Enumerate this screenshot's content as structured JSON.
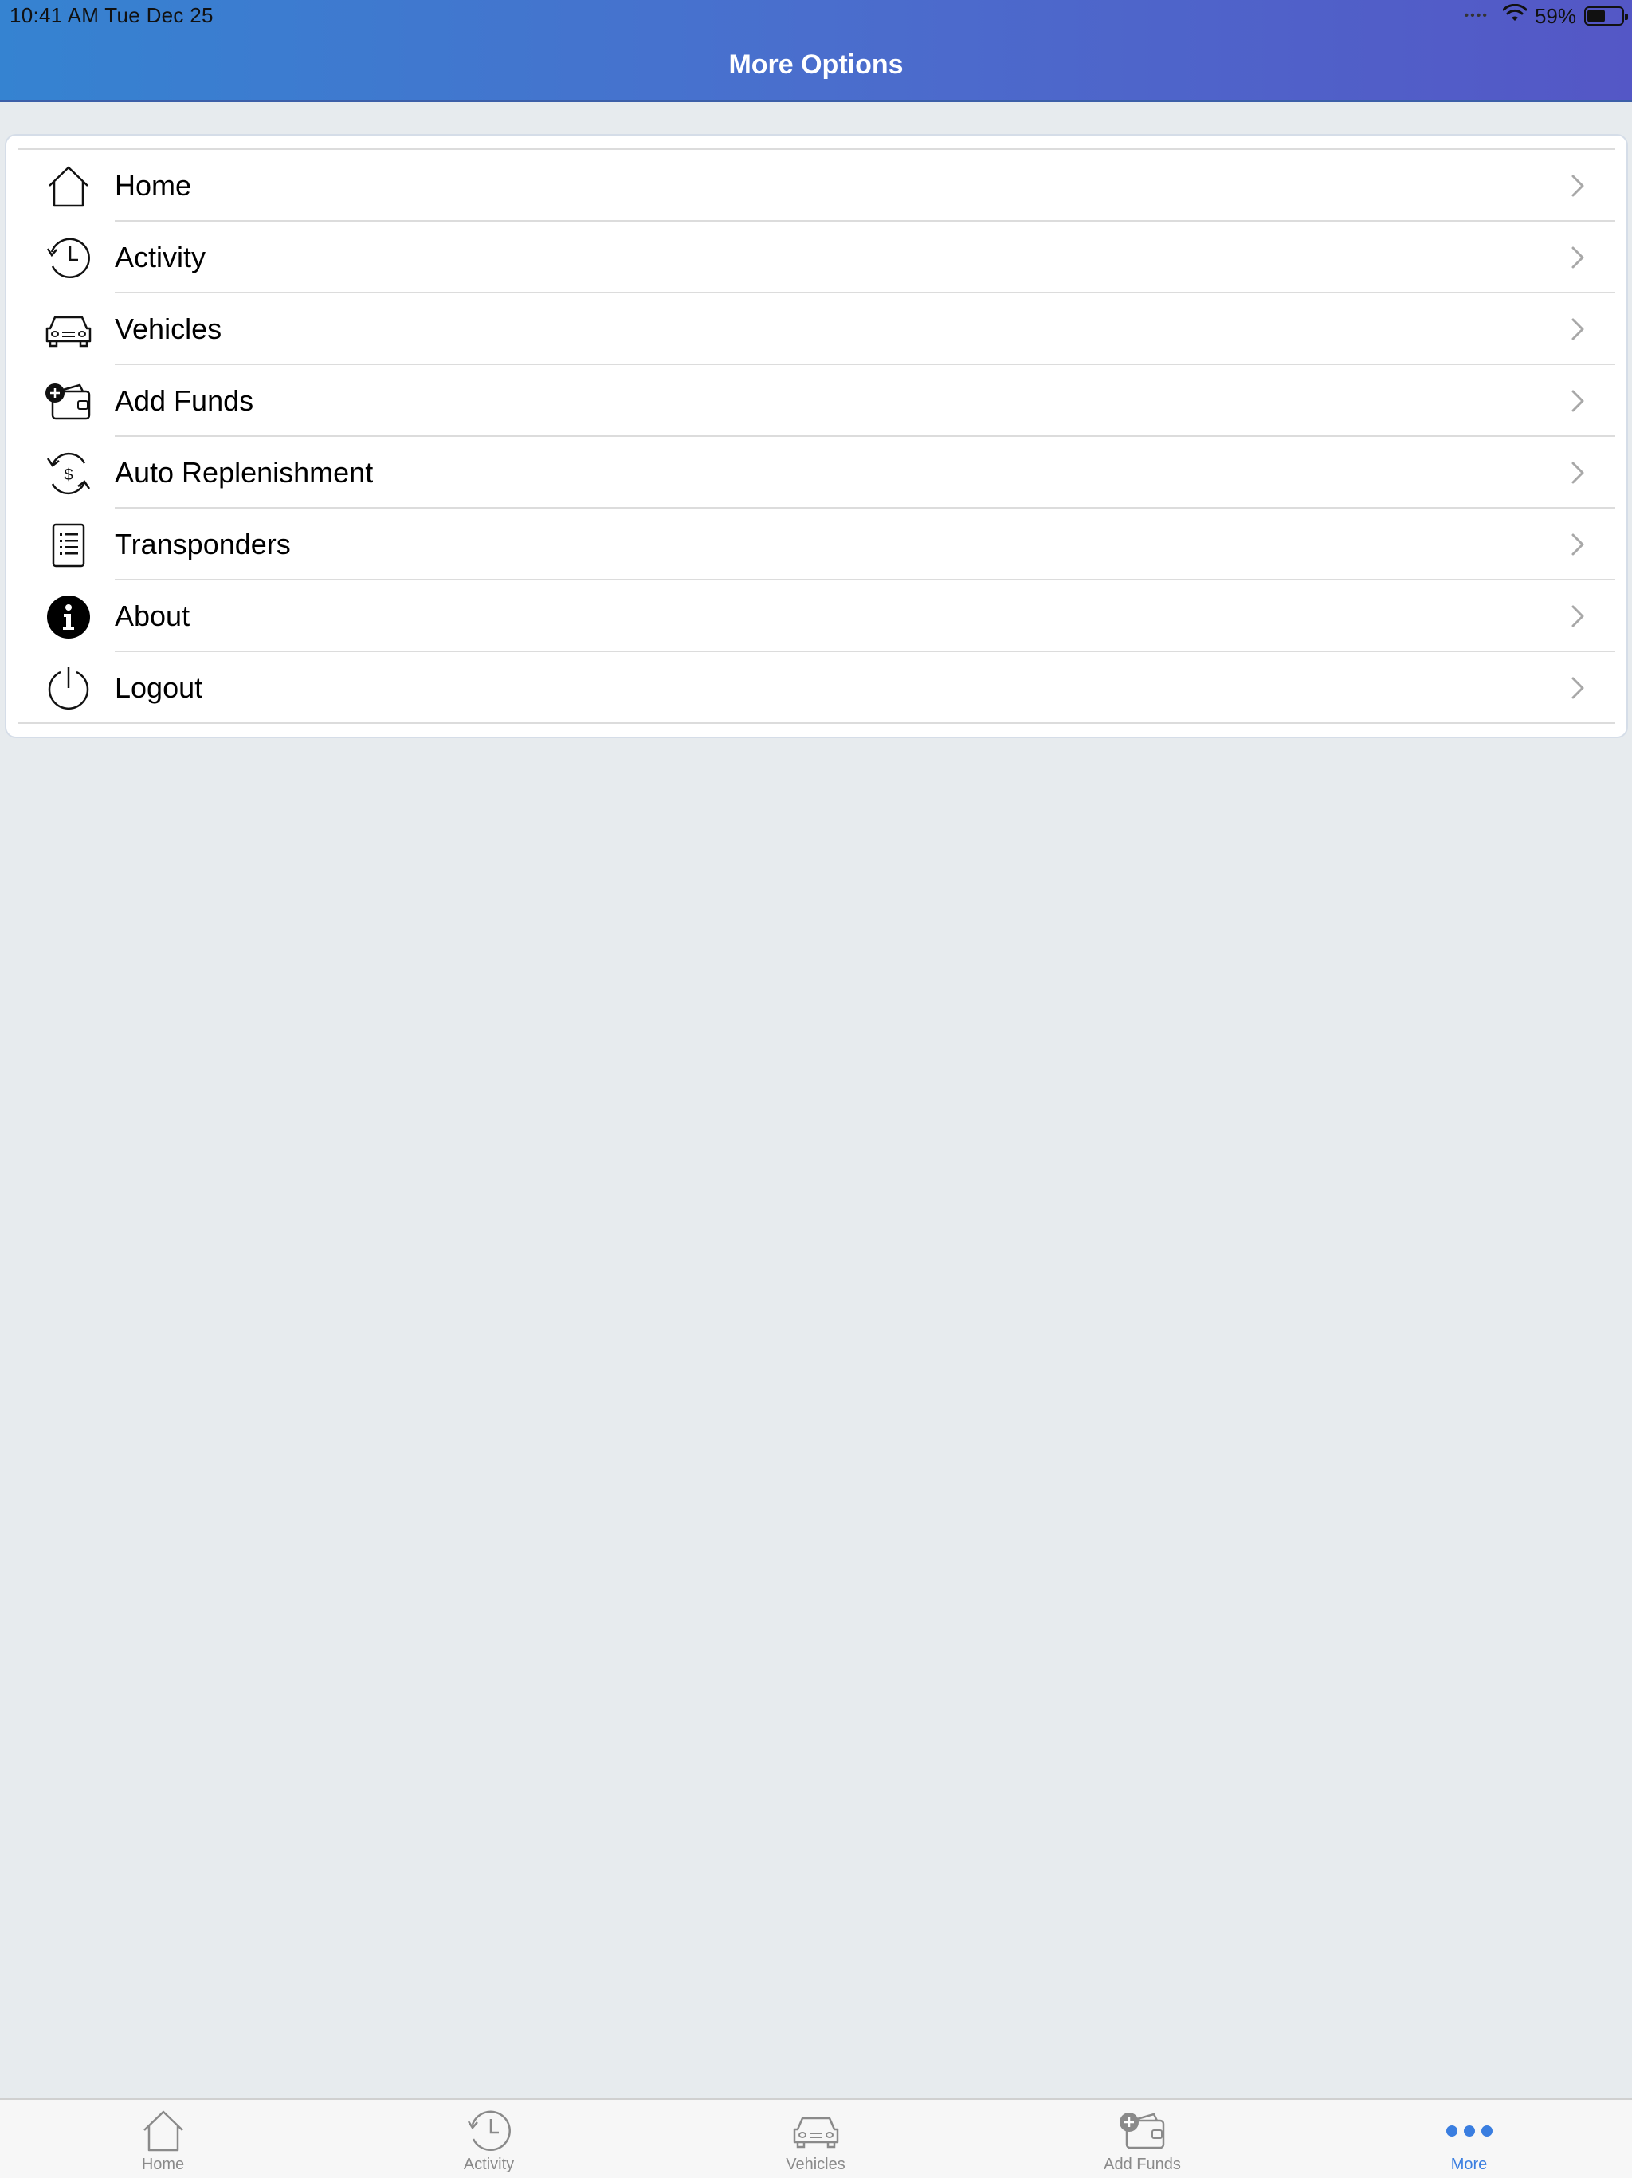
{
  "status_bar": {
    "time": "10:41 AM   Tue Dec 25",
    "signal_dots": "••••",
    "battery_text": "59%"
  },
  "header": {
    "title": "More Options"
  },
  "menu": {
    "items": [
      {
        "label": "Home",
        "icon": "home-icon"
      },
      {
        "label": "Activity",
        "icon": "history-clock-icon"
      },
      {
        "label": "Vehicles",
        "icon": "car-icon"
      },
      {
        "label": "Add Funds",
        "icon": "wallet-add-icon"
      },
      {
        "label": "Auto Replenishment",
        "icon": "dollar-refresh-icon"
      },
      {
        "label": "Transponders",
        "icon": "list-document-icon"
      },
      {
        "label": "About",
        "icon": "info-icon"
      },
      {
        "label": "Logout",
        "icon": "power-icon"
      }
    ]
  },
  "tabbar": {
    "tabs": [
      {
        "label": "Home",
        "icon": "home-icon",
        "active": false
      },
      {
        "label": "Activity",
        "icon": "history-clock-icon",
        "active": false
      },
      {
        "label": "Vehicles",
        "icon": "car-icon",
        "active": false
      },
      {
        "label": "Add Funds",
        "icon": "wallet-add-icon",
        "active": false
      },
      {
        "label": "More",
        "icon": "more-dots-icon",
        "active": true
      }
    ]
  },
  "colors": {
    "header_gradient_start": "#3583d1",
    "header_gradient_end": "#5457c6",
    "active_tab": "#3a7ee0",
    "inactive_tab": "#8a8a8a",
    "background": "#e7ebee"
  }
}
